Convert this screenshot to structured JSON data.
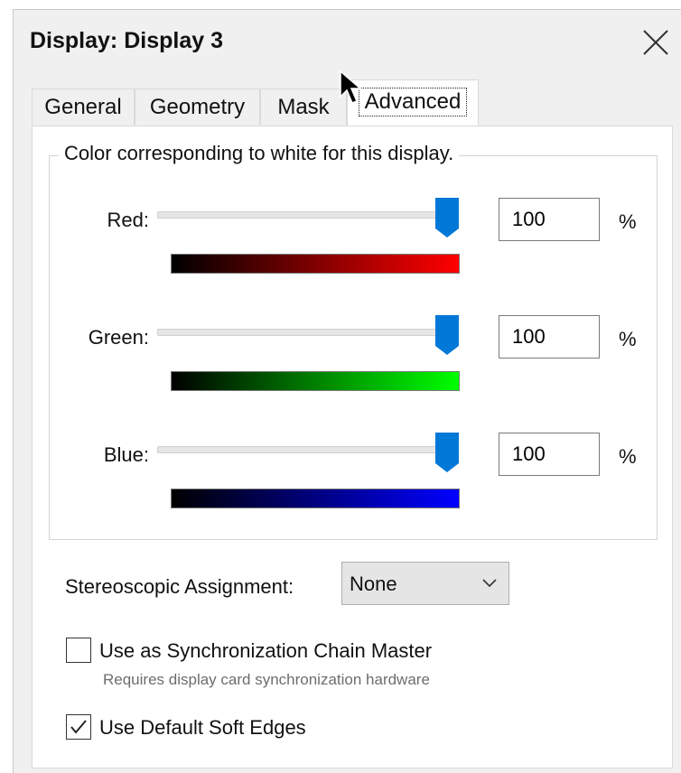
{
  "window": {
    "title": "Display: Display 3"
  },
  "tabs": [
    {
      "label": "General"
    },
    {
      "label": "Geometry"
    },
    {
      "label": "Mask"
    },
    {
      "label": "Advanced"
    }
  ],
  "active_tab": "Advanced",
  "color_group": {
    "legend": "Color corresponding to white for this display.",
    "channels": [
      {
        "label": "Red:",
        "value": "100",
        "unit": "%",
        "level": 1.0,
        "color": "#ff0000"
      },
      {
        "label": "Green:",
        "value": "100",
        "unit": "%",
        "level": 1.0,
        "color": "#00ff00"
      },
      {
        "label": "Blue:",
        "value": "100",
        "unit": "%",
        "level": 1.0,
        "color": "#0000ff"
      }
    ]
  },
  "stereo": {
    "label": "Stereoscopic Assignment:",
    "value": "None"
  },
  "sync_master": {
    "label": "Use as Synchronization Chain Master",
    "checked": false,
    "hint": "Requires display card synchronization hardware"
  },
  "soft_edges": {
    "label": "Use Default Soft Edges",
    "checked": true
  },
  "colors": {
    "accent": "#0078d7",
    "dialog_bg": "#f0f0f0",
    "panel_bg": "#ffffff"
  }
}
